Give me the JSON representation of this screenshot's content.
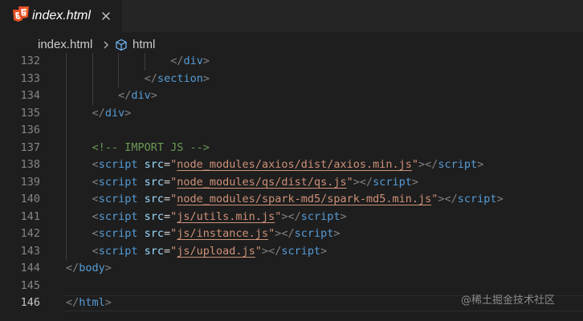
{
  "tab": {
    "title": "index.html",
    "file_icon": "html5-icon",
    "close_icon": "close-icon"
  },
  "breadcrumb": {
    "file": "index.html",
    "separator_icon": "chevron-right-icon",
    "symbol_icon": "cube-icon",
    "symbol": "html"
  },
  "editor": {
    "current_line": "146",
    "lines": [
      {
        "num": "132",
        "indent": 16,
        "segments": [
          [
            "punc",
            "</"
          ],
          [
            "tag",
            "div"
          ],
          [
            "punc",
            ">"
          ]
        ]
      },
      {
        "num": "133",
        "indent": 12,
        "segments": [
          [
            "punc",
            "</"
          ],
          [
            "tag",
            "section"
          ],
          [
            "punc",
            ">"
          ]
        ]
      },
      {
        "num": "134",
        "indent": 8,
        "segments": [
          [
            "punc",
            "</"
          ],
          [
            "tag",
            "div"
          ],
          [
            "punc",
            ">"
          ]
        ]
      },
      {
        "num": "135",
        "indent": 4,
        "segments": [
          [
            "punc",
            "</"
          ],
          [
            "tag",
            "div"
          ],
          [
            "punc",
            ">"
          ]
        ]
      },
      {
        "num": "136",
        "indent": 0,
        "segments": []
      },
      {
        "num": "137",
        "indent": 4,
        "segments": [
          [
            "comment",
            "<!-- IMPORT JS -->"
          ]
        ]
      },
      {
        "num": "138",
        "indent": 4,
        "segments": [
          [
            "punc",
            "<"
          ],
          [
            "tag",
            "script"
          ],
          [
            "text",
            " "
          ],
          [
            "attr",
            "src"
          ],
          [
            "text",
            "="
          ],
          [
            "str",
            "\""
          ],
          [
            "link",
            "node_modules/axios/dist/axios.min.js"
          ],
          [
            "str",
            "\""
          ],
          [
            "punc",
            "></"
          ],
          [
            "tag",
            "script"
          ],
          [
            "punc",
            ">"
          ]
        ]
      },
      {
        "num": "139",
        "indent": 4,
        "segments": [
          [
            "punc",
            "<"
          ],
          [
            "tag",
            "script"
          ],
          [
            "text",
            " "
          ],
          [
            "attr",
            "src"
          ],
          [
            "text",
            "="
          ],
          [
            "str",
            "\""
          ],
          [
            "link",
            "node_modules/qs/dist/qs.js"
          ],
          [
            "str",
            "\""
          ],
          [
            "punc",
            "></"
          ],
          [
            "tag",
            "script"
          ],
          [
            "punc",
            ">"
          ]
        ]
      },
      {
        "num": "140",
        "indent": 4,
        "segments": [
          [
            "punc",
            "<"
          ],
          [
            "tag",
            "script"
          ],
          [
            "text",
            " "
          ],
          [
            "attr",
            "src"
          ],
          [
            "text",
            "="
          ],
          [
            "str",
            "\""
          ],
          [
            "link",
            "node_modules/spark-md5/spark-md5.min.js"
          ],
          [
            "str",
            "\""
          ],
          [
            "punc",
            "></"
          ],
          [
            "tag",
            "script"
          ],
          [
            "punc",
            ">"
          ]
        ]
      },
      {
        "num": "141",
        "indent": 4,
        "segments": [
          [
            "punc",
            "<"
          ],
          [
            "tag",
            "script"
          ],
          [
            "text",
            " "
          ],
          [
            "attr",
            "src"
          ],
          [
            "text",
            "="
          ],
          [
            "str",
            "\""
          ],
          [
            "link",
            "js/utils.min.js"
          ],
          [
            "str",
            "\""
          ],
          [
            "punc",
            "></"
          ],
          [
            "tag",
            "script"
          ],
          [
            "punc",
            ">"
          ]
        ]
      },
      {
        "num": "142",
        "indent": 4,
        "segments": [
          [
            "punc",
            "<"
          ],
          [
            "tag",
            "script"
          ],
          [
            "text",
            " "
          ],
          [
            "attr",
            "src"
          ],
          [
            "text",
            "="
          ],
          [
            "str",
            "\""
          ],
          [
            "link",
            "js/instance.js"
          ],
          [
            "str",
            "\""
          ],
          [
            "punc",
            "></"
          ],
          [
            "tag",
            "script"
          ],
          [
            "punc",
            ">"
          ]
        ]
      },
      {
        "num": "143",
        "indent": 4,
        "segments": [
          [
            "punc",
            "<"
          ],
          [
            "tag",
            "script"
          ],
          [
            "text",
            " "
          ],
          [
            "attr",
            "src"
          ],
          [
            "text",
            "="
          ],
          [
            "str",
            "\""
          ],
          [
            "link",
            "js/upload.js"
          ],
          [
            "str",
            "\""
          ],
          [
            "punc",
            "></"
          ],
          [
            "tag",
            "script"
          ],
          [
            "punc",
            ">"
          ]
        ]
      },
      {
        "num": "144",
        "indent": 0,
        "segments": [
          [
            "punc",
            "</"
          ],
          [
            "tag",
            "body"
          ],
          [
            "punc",
            ">"
          ]
        ]
      },
      {
        "num": "145",
        "indent": 0,
        "segments": []
      },
      {
        "num": "146",
        "indent": 0,
        "segments": [
          [
            "punc",
            "</"
          ],
          [
            "tag",
            "html"
          ],
          [
            "punc",
            ">"
          ]
        ]
      }
    ]
  },
  "watermark": "@稀土掘金技术社区",
  "colors": {
    "background": "#1e1e1e",
    "tag": "#569cd6",
    "attribute": "#9cdcfe",
    "string": "#ce9178",
    "comment": "#6a9955",
    "punctuation": "#808080",
    "line_number": "#858585",
    "html5_orange": "#e44d26"
  }
}
